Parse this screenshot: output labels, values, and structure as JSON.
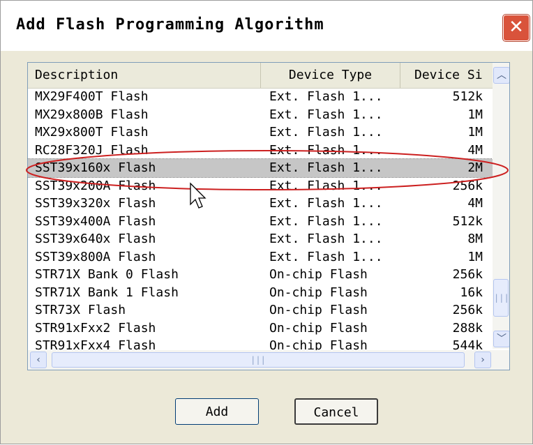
{
  "dialog": {
    "title": "Add Flash Programming Algorithm",
    "close_icon": "close-x-icon"
  },
  "list": {
    "columns": [
      "Description",
      "Device Type",
      "Device Si"
    ],
    "selected_index": 4,
    "rows": [
      {
        "description": "MX29F400T Flash",
        "type": "Ext. Flash 1...",
        "size": "512k"
      },
      {
        "description": "MX29x800B Flash",
        "type": "Ext. Flash 1...",
        "size": "1M"
      },
      {
        "description": "MX29x800T Flash",
        "type": "Ext. Flash 1...",
        "size": "1M"
      },
      {
        "description": "RC28F320J Flash",
        "type": "Ext. Flash 1...",
        "size": "4M"
      },
      {
        "description": "SST39x160x Flash",
        "type": "Ext. Flash 1...",
        "size": "2M"
      },
      {
        "description": "SST39x200A Flash",
        "type": "Ext. Flash 1...",
        "size": "256k"
      },
      {
        "description": "SST39x320x Flash",
        "type": "Ext. Flash 1...",
        "size": "4M"
      },
      {
        "description": "SST39x400A Flash",
        "type": "Ext. Flash 1...",
        "size": "512k"
      },
      {
        "description": "SST39x640x Flash",
        "type": "Ext. Flash 1...",
        "size": "8M"
      },
      {
        "description": "SST39x800A Flash",
        "type": "Ext. Flash 1...",
        "size": "1M"
      },
      {
        "description": "STR71X Bank 0 Flash",
        "type": "On-chip Flash",
        "size": "256k"
      },
      {
        "description": "STR71X Bank 1 Flash",
        "type": "On-chip Flash",
        "size": "16k"
      },
      {
        "description": "STR73X Flash",
        "type": "On-chip Flash",
        "size": "256k"
      },
      {
        "description": "STR91xFxx2 Flash",
        "type": "On-chip Flash",
        "size": "288k"
      },
      {
        "description": "STR91xFxx4 Flash",
        "type": "On-chip Flash",
        "size": "544k"
      }
    ]
  },
  "scroll": {
    "up_icon": "chevron-up-icon",
    "down_icon": "chevron-down-icon",
    "left_icon": "chevron-left-icon",
    "right_icon": "chevron-right-icon",
    "grip": "|||"
  },
  "buttons": {
    "add": "Add",
    "cancel": "Cancel"
  }
}
